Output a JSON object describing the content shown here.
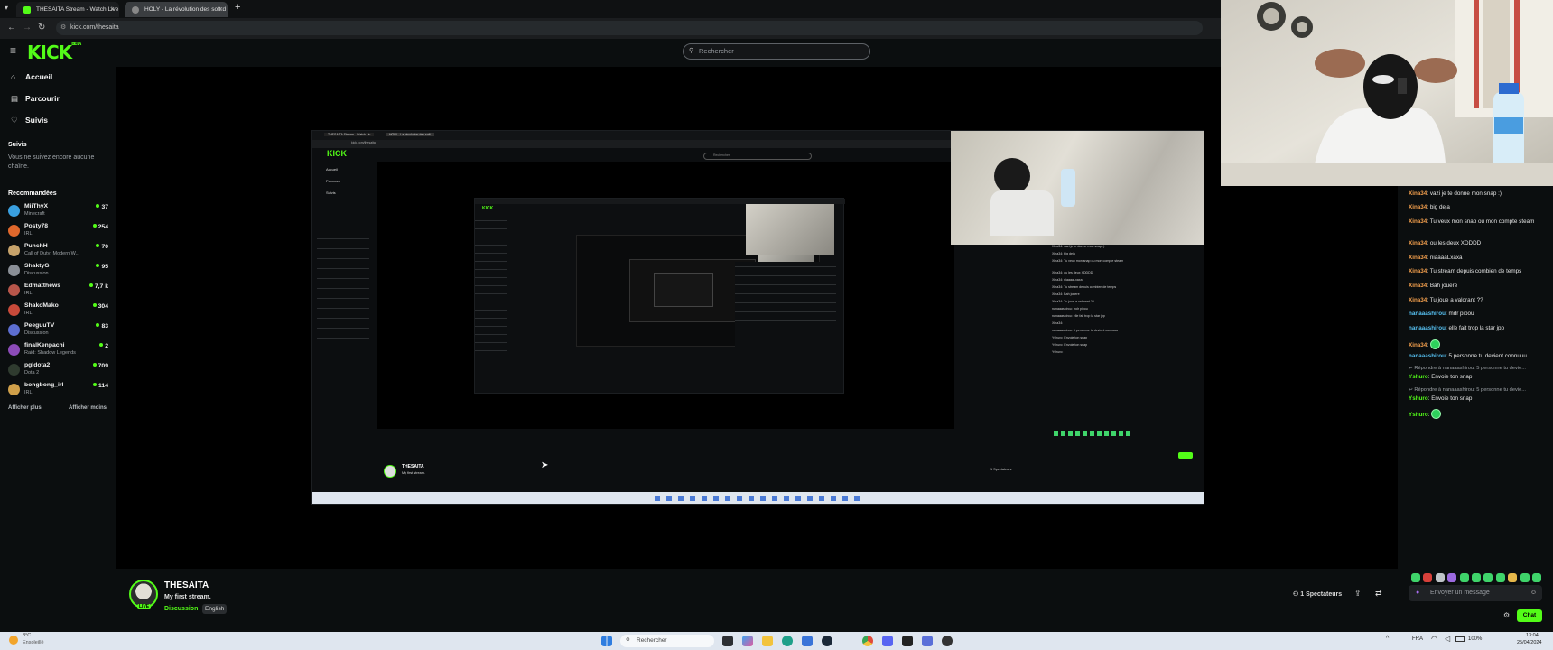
{
  "browser": {
    "tabs": [
      {
        "label": "THESAITA Stream - Watch Live",
        "active": true
      },
      {
        "label": "HOLY - La révolution des soft d",
        "active": false
      }
    ],
    "url": "kick.com/thesaita"
  },
  "header": {
    "logo": "KICK",
    "logo_sup": "BETA",
    "search_placeholder": "Rechercher"
  },
  "sidebar": {
    "nav": [
      {
        "label": "Accueil",
        "icon": "home-icon"
      },
      {
        "label": "Parcourir",
        "icon": "browse-icon"
      },
      {
        "label": "Suivis",
        "icon": "heart-icon"
      }
    ],
    "following_title": "Suivis",
    "following_empty": "Vous ne suivez encore aucune chaîne.",
    "recommended_title": "Recommandées",
    "recommended": [
      {
        "name": "MiiThyX",
        "category": "Minecraft",
        "viewers": "37",
        "color": "#3aa0e0"
      },
      {
        "name": "Posty78",
        "category": "IRL",
        "viewers": "254",
        "color": "#e0682c"
      },
      {
        "name": "PunchH",
        "category": "Call of Duty: Modern W...",
        "viewers": "70",
        "color": "#c7a36b"
      },
      {
        "name": "ShaktyG",
        "category": "Discussion",
        "viewers": "95",
        "color": "#8a8f96"
      },
      {
        "name": "Edmatthews",
        "category": "IRL",
        "viewers": "7,7 k",
        "color": "#b8564a"
      },
      {
        "name": "ShakoMako",
        "category": "IRL",
        "viewers": "304",
        "color": "#c84a3a"
      },
      {
        "name": "PeeguuTV",
        "category": "Discussion",
        "viewers": "83",
        "color": "#5d6ed1"
      },
      {
        "name": "finalKenpachi",
        "category": "Raid: Shadow Legends",
        "viewers": "2",
        "color": "#8c4bb8"
      },
      {
        "name": "pgldota2",
        "category": "Dota 2",
        "viewers": "709",
        "color": "#2f3b2f"
      },
      {
        "name": "bongbong_irl",
        "category": "IRL",
        "viewers": "114",
        "color": "#d0a04a"
      }
    ],
    "show_more": "Afficher plus",
    "show_less": "Afficher moins"
  },
  "stream": {
    "streamer": "THESAITA",
    "title": "My first stream.",
    "category": "Discussion",
    "language": "English",
    "live_label": "LIVE",
    "viewers_label": "1 Spectateurs"
  },
  "chat": {
    "messages": [
      {
        "user": "Xina34",
        "text": "vazi je te donne mon snap :)",
        "color": "#f29e4c"
      },
      {
        "user": "Xina34",
        "text": "big deja",
        "color": "#f29e4c"
      },
      {
        "user": "Xina34",
        "text": "Tu veux mon snap ou mon compte steam",
        "color": "#f29e4c"
      },
      {
        "user": "Xina34",
        "text": "ou les deux XDDDD",
        "color": "#f29e4c"
      },
      {
        "user": "Xina34",
        "text": "niaaaaLxaxa",
        "color": "#f29e4c"
      },
      {
        "user": "Xina34",
        "text": "Tu stream depuis combien de temps",
        "color": "#f29e4c"
      },
      {
        "user": "Xina34",
        "text": "Bah jouere",
        "color": "#f29e4c"
      },
      {
        "user": "Xina34",
        "text": "Tu joue a valorant ??",
        "color": "#f29e4c"
      },
      {
        "user": "nanaaashirou",
        "text": "mdr pipou",
        "color": "#56c1f2"
      },
      {
        "user": "nanaaashirou",
        "text": "elle fait trop la star jpp",
        "color": "#56c1f2"
      },
      {
        "user": "Xina34",
        "text": "",
        "color": "#f29e4c",
        "emote": true
      },
      {
        "user": "nanaaashirou",
        "text": "5 personne tu devient connuuu",
        "color": "#56c1f2"
      }
    ],
    "reply_1": "Répondre à nanaaashirou: 5 personne tu devie...",
    "reply_1_msg": {
      "user": "Yshuro",
      "text": "Envoie ton snap",
      "color": "#53fc18"
    },
    "reply_2": "Répondre à nanaaashirou: 5 personne tu devie...",
    "reply_2_msg": {
      "user": "Yshuro",
      "text": "Envoie ton snap",
      "color": "#53fc18"
    },
    "last_msg": {
      "user": "Yshuro",
      "text": "",
      "color": "#53fc18"
    },
    "input_placeholder": "Envoyer un message",
    "send_label": "Chat"
  },
  "taskbar": {
    "weather_temp": "8°C",
    "weather_desc": "Ensoleillé",
    "search_placeholder": "Rechercher",
    "lang": "FRA",
    "battery": "100%",
    "time": "13:04",
    "date": "25/04/2024"
  },
  "nested": {
    "tab1": "THESAITA Stream - Watch Liv",
    "tab2": "HOLY - La révolution des soft",
    "url": "kick.com/thesaita",
    "logo": "KICK",
    "search": "Rechercher",
    "nav": [
      "Accueil",
      "Parcourir",
      "Suivis"
    ],
    "streamer": "THESAITA",
    "title": "My first stream.",
    "spectators": "1 Spectateurs",
    "chat_lines": [
      "Xina34: vazi je te donne mon snap :)",
      "Xina34: big deja",
      "Xina34: Tu veux mon snap ou mon compte steam",
      "Xina34: ou les deux XDDDD",
      "Xina34: niaaaaLxaxa",
      "Xina34: Tu stream depuis combien de temps",
      "Xina34: Bah jouere",
      "Xina34: Tu joue a valorant ??",
      "nanaaashirou: mdr pipou",
      "nanaaashirou: elle fait trop la star jpp",
      "Xina34:",
      "nanaaashirou: 5 personne tu devient connuuu",
      "Yshuro: Envoie ton snap",
      "Yshuro: Envoie ton snap",
      "Yshuro:"
    ]
  }
}
